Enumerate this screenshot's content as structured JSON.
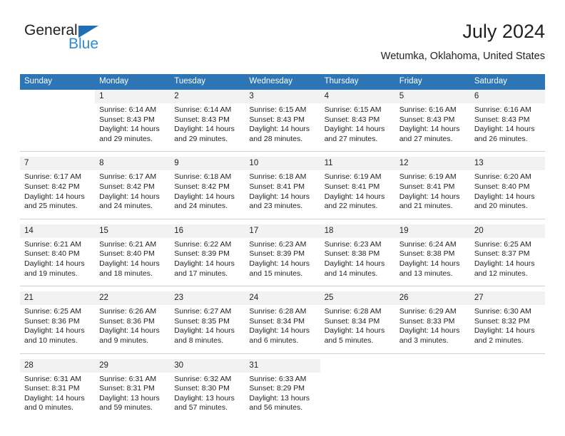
{
  "brand": {
    "name_part1": "General",
    "name_part2": "Blue",
    "accent_color": "#2e8bd4",
    "triangle_color": "#1f6fb5"
  },
  "header": {
    "title": "July 2024",
    "subtitle": "Wetumka, Oklahoma, United States",
    "header_bg_color": "#2e75b6"
  },
  "weekday_headers": [
    "Sunday",
    "Monday",
    "Tuesday",
    "Wednesday",
    "Thursday",
    "Friday",
    "Saturday"
  ],
  "weeks": [
    {
      "days": [
        {
          "num": "",
          "sunrise": "",
          "sunset": "",
          "daylight_a": "",
          "daylight_b": ""
        },
        {
          "num": "1",
          "sunrise": "Sunrise: 6:14 AM",
          "sunset": "Sunset: 8:43 PM",
          "daylight_a": "Daylight: 14 hours",
          "daylight_b": "and 29 minutes."
        },
        {
          "num": "2",
          "sunrise": "Sunrise: 6:14 AM",
          "sunset": "Sunset: 8:43 PM",
          "daylight_a": "Daylight: 14 hours",
          "daylight_b": "and 29 minutes."
        },
        {
          "num": "3",
          "sunrise": "Sunrise: 6:15 AM",
          "sunset": "Sunset: 8:43 PM",
          "daylight_a": "Daylight: 14 hours",
          "daylight_b": "and 28 minutes."
        },
        {
          "num": "4",
          "sunrise": "Sunrise: 6:15 AM",
          "sunset": "Sunset: 8:43 PM",
          "daylight_a": "Daylight: 14 hours",
          "daylight_b": "and 27 minutes."
        },
        {
          "num": "5",
          "sunrise": "Sunrise: 6:16 AM",
          "sunset": "Sunset: 8:43 PM",
          "daylight_a": "Daylight: 14 hours",
          "daylight_b": "and 27 minutes."
        },
        {
          "num": "6",
          "sunrise": "Sunrise: 6:16 AM",
          "sunset": "Sunset: 8:43 PM",
          "daylight_a": "Daylight: 14 hours",
          "daylight_b": "and 26 minutes."
        }
      ]
    },
    {
      "days": [
        {
          "num": "7",
          "sunrise": "Sunrise: 6:17 AM",
          "sunset": "Sunset: 8:42 PM",
          "daylight_a": "Daylight: 14 hours",
          "daylight_b": "and 25 minutes."
        },
        {
          "num": "8",
          "sunrise": "Sunrise: 6:17 AM",
          "sunset": "Sunset: 8:42 PM",
          "daylight_a": "Daylight: 14 hours",
          "daylight_b": "and 24 minutes."
        },
        {
          "num": "9",
          "sunrise": "Sunrise: 6:18 AM",
          "sunset": "Sunset: 8:42 PM",
          "daylight_a": "Daylight: 14 hours",
          "daylight_b": "and 24 minutes."
        },
        {
          "num": "10",
          "sunrise": "Sunrise: 6:18 AM",
          "sunset": "Sunset: 8:41 PM",
          "daylight_a": "Daylight: 14 hours",
          "daylight_b": "and 23 minutes."
        },
        {
          "num": "11",
          "sunrise": "Sunrise: 6:19 AM",
          "sunset": "Sunset: 8:41 PM",
          "daylight_a": "Daylight: 14 hours",
          "daylight_b": "and 22 minutes."
        },
        {
          "num": "12",
          "sunrise": "Sunrise: 6:19 AM",
          "sunset": "Sunset: 8:41 PM",
          "daylight_a": "Daylight: 14 hours",
          "daylight_b": "and 21 minutes."
        },
        {
          "num": "13",
          "sunrise": "Sunrise: 6:20 AM",
          "sunset": "Sunset: 8:40 PM",
          "daylight_a": "Daylight: 14 hours",
          "daylight_b": "and 20 minutes."
        }
      ]
    },
    {
      "days": [
        {
          "num": "14",
          "sunrise": "Sunrise: 6:21 AM",
          "sunset": "Sunset: 8:40 PM",
          "daylight_a": "Daylight: 14 hours",
          "daylight_b": "and 19 minutes."
        },
        {
          "num": "15",
          "sunrise": "Sunrise: 6:21 AM",
          "sunset": "Sunset: 8:40 PM",
          "daylight_a": "Daylight: 14 hours",
          "daylight_b": "and 18 minutes."
        },
        {
          "num": "16",
          "sunrise": "Sunrise: 6:22 AM",
          "sunset": "Sunset: 8:39 PM",
          "daylight_a": "Daylight: 14 hours",
          "daylight_b": "and 17 minutes."
        },
        {
          "num": "17",
          "sunrise": "Sunrise: 6:23 AM",
          "sunset": "Sunset: 8:39 PM",
          "daylight_a": "Daylight: 14 hours",
          "daylight_b": "and 15 minutes."
        },
        {
          "num": "18",
          "sunrise": "Sunrise: 6:23 AM",
          "sunset": "Sunset: 8:38 PM",
          "daylight_a": "Daylight: 14 hours",
          "daylight_b": "and 14 minutes."
        },
        {
          "num": "19",
          "sunrise": "Sunrise: 6:24 AM",
          "sunset": "Sunset: 8:38 PM",
          "daylight_a": "Daylight: 14 hours",
          "daylight_b": "and 13 minutes."
        },
        {
          "num": "20",
          "sunrise": "Sunrise: 6:25 AM",
          "sunset": "Sunset: 8:37 PM",
          "daylight_a": "Daylight: 14 hours",
          "daylight_b": "and 12 minutes."
        }
      ]
    },
    {
      "days": [
        {
          "num": "21",
          "sunrise": "Sunrise: 6:25 AM",
          "sunset": "Sunset: 8:36 PM",
          "daylight_a": "Daylight: 14 hours",
          "daylight_b": "and 10 minutes."
        },
        {
          "num": "22",
          "sunrise": "Sunrise: 6:26 AM",
          "sunset": "Sunset: 8:36 PM",
          "daylight_a": "Daylight: 14 hours",
          "daylight_b": "and 9 minutes."
        },
        {
          "num": "23",
          "sunrise": "Sunrise: 6:27 AM",
          "sunset": "Sunset: 8:35 PM",
          "daylight_a": "Daylight: 14 hours",
          "daylight_b": "and 8 minutes."
        },
        {
          "num": "24",
          "sunrise": "Sunrise: 6:28 AM",
          "sunset": "Sunset: 8:34 PM",
          "daylight_a": "Daylight: 14 hours",
          "daylight_b": "and 6 minutes."
        },
        {
          "num": "25",
          "sunrise": "Sunrise: 6:28 AM",
          "sunset": "Sunset: 8:34 PM",
          "daylight_a": "Daylight: 14 hours",
          "daylight_b": "and 5 minutes."
        },
        {
          "num": "26",
          "sunrise": "Sunrise: 6:29 AM",
          "sunset": "Sunset: 8:33 PM",
          "daylight_a": "Daylight: 14 hours",
          "daylight_b": "and 3 minutes."
        },
        {
          "num": "27",
          "sunrise": "Sunrise: 6:30 AM",
          "sunset": "Sunset: 8:32 PM",
          "daylight_a": "Daylight: 14 hours",
          "daylight_b": "and 2 minutes."
        }
      ]
    },
    {
      "days": [
        {
          "num": "28",
          "sunrise": "Sunrise: 6:31 AM",
          "sunset": "Sunset: 8:31 PM",
          "daylight_a": "Daylight: 14 hours",
          "daylight_b": "and 0 minutes."
        },
        {
          "num": "29",
          "sunrise": "Sunrise: 6:31 AM",
          "sunset": "Sunset: 8:31 PM",
          "daylight_a": "Daylight: 13 hours",
          "daylight_b": "and 59 minutes."
        },
        {
          "num": "30",
          "sunrise": "Sunrise: 6:32 AM",
          "sunset": "Sunset: 8:30 PM",
          "daylight_a": "Daylight: 13 hours",
          "daylight_b": "and 57 minutes."
        },
        {
          "num": "31",
          "sunrise": "Sunrise: 6:33 AM",
          "sunset": "Sunset: 8:29 PM",
          "daylight_a": "Daylight: 13 hours",
          "daylight_b": "and 56 minutes."
        },
        {
          "num": "",
          "sunrise": "",
          "sunset": "",
          "daylight_a": "",
          "daylight_b": ""
        },
        {
          "num": "",
          "sunrise": "",
          "sunset": "",
          "daylight_a": "",
          "daylight_b": ""
        },
        {
          "num": "",
          "sunrise": "",
          "sunset": "",
          "daylight_a": "",
          "daylight_b": ""
        }
      ]
    }
  ]
}
